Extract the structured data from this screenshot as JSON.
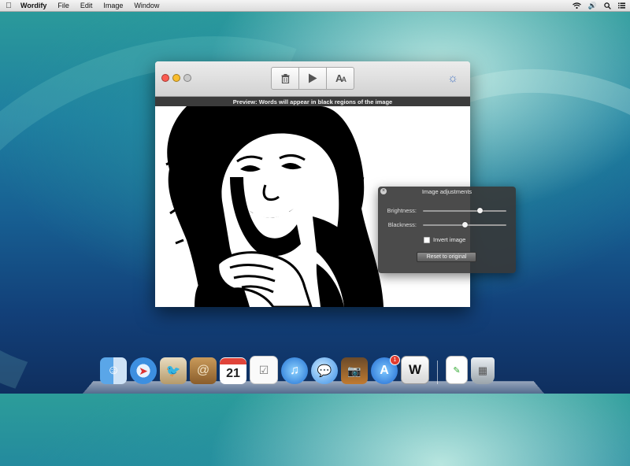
{
  "menubar": {
    "app_name": "Wordify",
    "items": [
      "File",
      "Edit",
      "Image",
      "Window"
    ]
  },
  "window": {
    "toolbar": {
      "delete_icon": "trash-icon",
      "play_icon": "play-icon",
      "font_icon": "font-size-icon",
      "font_glyph": "A",
      "settings_icon": "brightness-icon"
    },
    "preview_text": "Preview: Words will appear in black regions of the image"
  },
  "hud": {
    "title": "Image adjustments",
    "brightness_label": "Brightness:",
    "brightness_value": 0.68,
    "blackness_label": "Blackness:",
    "blackness_value": 0.5,
    "invert_label": "Invert image",
    "invert_checked": false,
    "reset_label": "Reset to original"
  },
  "dock": {
    "calendar_day": "21",
    "app_store_badge": "1",
    "word_glyph": "W"
  },
  "colors": {
    "traffic_red": "#fb5b51",
    "traffic_yellow": "#f9bd2e",
    "accent_blue": "#4a78c4"
  }
}
